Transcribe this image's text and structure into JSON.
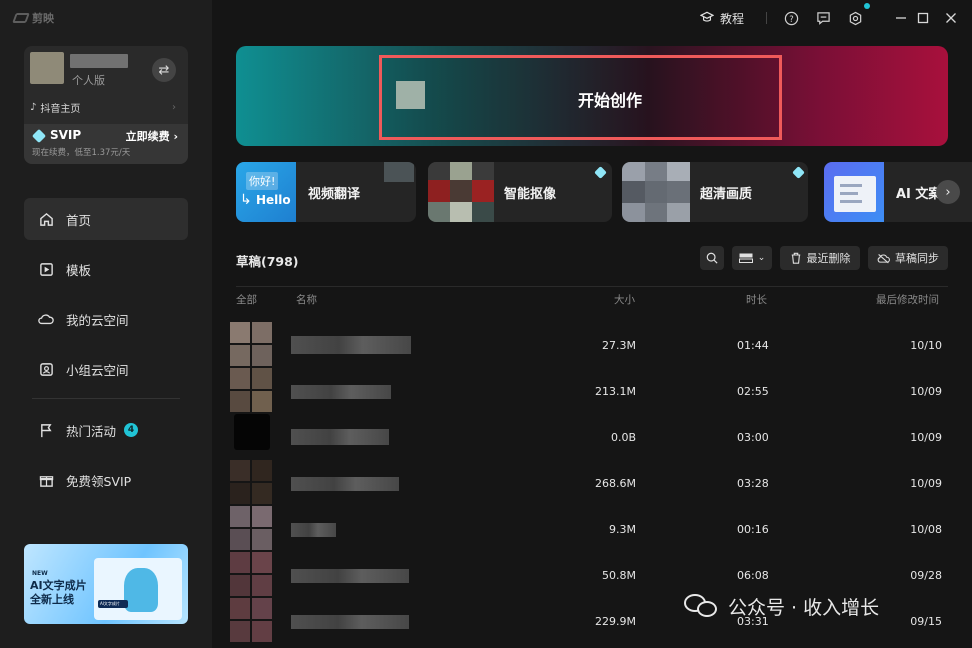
{
  "app": {
    "logo_text": "剪映"
  },
  "titlebar": {
    "tutorial_label": "教程"
  },
  "profile": {
    "tier": "个人版",
    "douyin_link": "抖音主页",
    "svip_label": "SVIP",
    "svip_action": "立即续费",
    "svip_sub": "现在续费，低至1.37元/天"
  },
  "nav": {
    "items": [
      {
        "label": "首页",
        "icon": "home-icon"
      },
      {
        "label": "模板",
        "icon": "template-icon"
      },
      {
        "label": "我的云空间",
        "icon": "cloud-icon"
      },
      {
        "label": "小组云空间",
        "icon": "team-cloud-icon"
      },
      {
        "label": "热门活动",
        "icon": "flag-icon",
        "badge": "4"
      },
      {
        "label": "免费领SVIP",
        "icon": "gift-icon"
      }
    ]
  },
  "promo": {
    "new_tag": "NEW",
    "line1": "AI文字成片",
    "line2": "全新上线",
    "chip_text": "AI文字成片"
  },
  "hero": {
    "label": "开始创作"
  },
  "features": [
    {
      "label": "视频翻译",
      "thumb_text1": "你好!",
      "thumb_text2": "Hello"
    },
    {
      "label": "智能抠像",
      "premium": true
    },
    {
      "label": "超清画质",
      "premium": true
    },
    {
      "label": "AI 文案"
    }
  ],
  "drafts": {
    "title": "草稿(798)",
    "recent_delete": "最近删除",
    "sync": "草稿同步",
    "columns": {
      "all": "全部",
      "name": "名称",
      "size": "大小",
      "duration": "时长",
      "modified": "最后修改时间"
    },
    "rows": [
      {
        "size": "27.3M",
        "duration": "01:44",
        "date": "10/10"
      },
      {
        "size": "213.1M",
        "duration": "02:55",
        "date": "10/09"
      },
      {
        "size": "0.0B",
        "duration": "03:00",
        "date": "10/09"
      },
      {
        "size": "268.6M",
        "duration": "03:28",
        "date": "10/09"
      },
      {
        "size": "9.3M",
        "duration": "00:16",
        "date": "10/08"
      },
      {
        "size": "50.8M",
        "duration": "06:08",
        "date": "09/28"
      },
      {
        "size": "229.9M",
        "duration": "03:31",
        "date": "09/15"
      }
    ]
  },
  "watermark": "公众号 · 收入增长",
  "colors": {
    "accent": "#21c4d6",
    "highlight_box": "#ef5a5a",
    "background": "#151515",
    "sidebar": "#1e1e1e"
  }
}
